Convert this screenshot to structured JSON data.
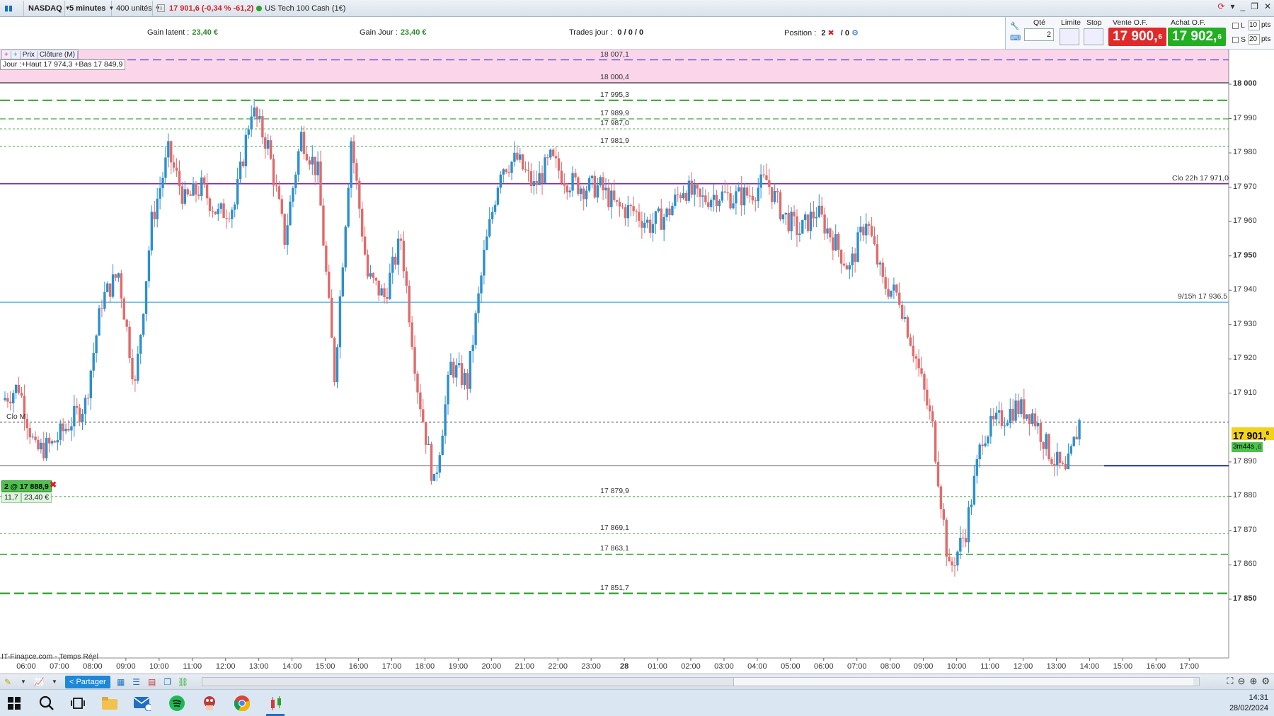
{
  "toolbar": {
    "instrument": "NASDAQ",
    "period": "5 minutes",
    "units": "400 unités",
    "quote": "17 901,6 (-0,34 % -61,2)",
    "market_name": "US Tech 100 Cash (1€)"
  },
  "infobar": {
    "gain_latent_label": "Gain latent :",
    "gain_latent_value": "23,40 €",
    "gain_jour_label": "Gain Jour :",
    "gain_jour_value": "23,40 €",
    "trades_label": "Trades jour :",
    "trades_value": "0 / 0 / 0",
    "position_label": "Position :",
    "position_value": "2",
    "position_sep": "/ 0"
  },
  "order_panel": {
    "qty_label": "Qté",
    "qty_value": "2",
    "limit_label": "Limite",
    "stop_label": "Stop",
    "sell_label": "Vente O.F.",
    "buy_label": "Achat O.F.",
    "sell_price": "17 900,",
    "sell_price_sup": "6",
    "buy_price": "17 902,",
    "buy_price_sup": "6",
    "l_label": "L",
    "l_value": "10",
    "s_label": "S",
    "s_value": "20",
    "pts_label": "pts",
    "sell_color": "#e02a2a",
    "buy_color": "#22b022"
  },
  "chart": {
    "tabs": [
      "Prix",
      "Clôture (M)"
    ],
    "day_info": "Jour :+Haut 17 974,3 +Bas 17 849,9",
    "level_labels": [
      {
        "text": "18 007,1",
        "price": 18007.1
      },
      {
        "text": "18 000,4",
        "price": 18000.4
      },
      {
        "text": "17 995,3",
        "price": 17995.3
      },
      {
        "text": "17 989,9",
        "price": 17989.9
      },
      {
        "text": "17 987,0",
        "price": 17987.0
      },
      {
        "text": "17 981,9",
        "price": 17981.9
      },
      {
        "text": "17 879,9",
        "price": 17879.9
      },
      {
        "text": "17 869,1",
        "price": 17869.1
      },
      {
        "text": "17 863,1",
        "price": 17863.1
      },
      {
        "text": "17 851,7",
        "price": 17851.7
      }
    ],
    "clo22_label": "Clo 22h 17 971,0",
    "h915_label": "9/15h 17 936,5",
    "clo_m_label": "Clo M",
    "position_tag": "2 @ 17 888,9",
    "pnl_points": "11,7",
    "pnl_value": "23,40 €",
    "current_price": "17 901,",
    "current_price_sup": "6",
    "timer": "3m44s",
    "timer_tail": ",6",
    "source": "IT-Finance.com - Temps Réel",
    "y_axis": [
      {
        "text": "18 000",
        "price": 18000,
        "bold": true
      },
      {
        "text": "17 990",
        "price": 17990,
        "bold": false
      },
      {
        "text": "17 980",
        "price": 17980,
        "bold": false
      },
      {
        "text": "17 970",
        "price": 17970,
        "bold": false
      },
      {
        "text": "17 960",
        "price": 17960,
        "bold": false
      },
      {
        "text": "17 950",
        "price": 17950,
        "bold": true
      },
      {
        "text": "17 940",
        "price": 17940,
        "bold": false
      },
      {
        "text": "17 930",
        "price": 17930,
        "bold": false
      },
      {
        "text": "17 920",
        "price": 17920,
        "bold": false
      },
      {
        "text": "17 910",
        "price": 17910,
        "bold": false
      },
      {
        "text": "17 890",
        "price": 17890,
        "bold": false
      },
      {
        "text": "17 880",
        "price": 17880,
        "bold": false
      },
      {
        "text": "17 870",
        "price": 17870,
        "bold": false
      },
      {
        "text": "17 860",
        "price": 17860,
        "bold": false
      },
      {
        "text": "17 850",
        "price": 17850,
        "bold": true
      }
    ],
    "x_axis": [
      "06:00",
      "07:00",
      "08:00",
      "09:00",
      "10:00",
      "11:00",
      "12:00",
      "13:00",
      "14:00",
      "15:00",
      "16:00",
      "17:00",
      "18:00",
      "19:00",
      "20:00",
      "21:00",
      "22:00",
      "23:00",
      "28",
      "01:00",
      "02:00",
      "03:00",
      "04:00",
      "05:00",
      "06:00",
      "07:00",
      "08:00",
      "09:00",
      "10:00",
      "11:00",
      "12:00",
      "13:00",
      "14:00",
      "15:00",
      "16:00",
      "17:00"
    ]
  },
  "chart_data": {
    "type": "candlestick",
    "instrument": "NASDAQ",
    "period": "5 minutes",
    "y_range": [
      17845,
      18010
    ],
    "levels": [
      18007.1,
      18000.4,
      17995.3,
      17989.9,
      17987.0,
      17981.9,
      17971.0,
      17936.5,
      17901.6,
      17888.9,
      17879.9,
      17869.1,
      17863.1,
      17851.7
    ],
    "price_path": [
      [
        "06:00",
        17908
      ],
      [
        "06:30",
        17912
      ],
      [
        "07:00",
        17893
      ],
      [
        "07:30",
        17895
      ],
      [
        "08:00",
        17901
      ],
      [
        "08:30",
        17907
      ],
      [
        "09:00",
        17937
      ],
      [
        "09:30",
        17945
      ],
      [
        "10:00",
        17912
      ],
      [
        "10:30",
        17960
      ],
      [
        "11:00",
        17980
      ],
      [
        "11:30",
        17966
      ],
      [
        "12:00",
        17970
      ],
      [
        "12:30",
        17962
      ],
      [
        "13:00",
        17965
      ],
      [
        "13:30",
        17993
      ],
      [
        "14:00",
        17982
      ],
      [
        "14:30",
        17955
      ],
      [
        "15:00",
        17985
      ],
      [
        "15:30",
        17974
      ],
      [
        "16:00",
        17915
      ],
      [
        "16:30",
        17984
      ],
      [
        "17:00",
        17944
      ],
      [
        "17:30",
        17938
      ],
      [
        "18:00",
        17955
      ],
      [
        "18:30",
        17912
      ],
      [
        "19:00",
        17883
      ],
      [
        "19:30",
        17918
      ],
      [
        "20:00",
        17913
      ],
      [
        "20:30",
        17950
      ],
      [
        "21:00",
        17976
      ],
      [
        "21:30",
        17978
      ],
      [
        "22:00",
        17970
      ],
      [
        "22:30",
        17978
      ],
      [
        "23:00",
        17972
      ],
      [
        "23:30",
        17970
      ],
      [
        "00:00",
        17970
      ],
      [
        "00:30",
        17964
      ],
      [
        "01:00",
        17963
      ],
      [
        "01:30",
        17959
      ],
      [
        "02:00",
        17962
      ],
      [
        "02:30",
        17970
      ],
      [
        "03:00",
        17966
      ],
      [
        "03:30",
        17968
      ],
      [
        "04:00",
        17967
      ],
      [
        "04:30",
        17968
      ],
      [
        "05:00",
        17972
      ],
      [
        "05:30",
        17962
      ],
      [
        "06:00",
        17957
      ],
      [
        "06:30",
        17963
      ],
      [
        "07:00",
        17955
      ],
      [
        "07:30",
        17946
      ],
      [
        "08:00",
        17961
      ],
      [
        "08:30",
        17942
      ],
      [
        "09:00",
        17938
      ],
      [
        "09:30",
        17920
      ],
      [
        "10:00",
        17900
      ],
      [
        "10:30",
        17858
      ],
      [
        "11:00",
        17870
      ],
      [
        "11:30",
        17898
      ],
      [
        "12:00",
        17902
      ],
      [
        "12:30",
        17906
      ],
      [
        "13:00",
        17904
      ],
      [
        "13:30",
        17893
      ],
      [
        "14:00",
        17886
      ],
      [
        "14:20",
        17901.6
      ]
    ]
  }
}
